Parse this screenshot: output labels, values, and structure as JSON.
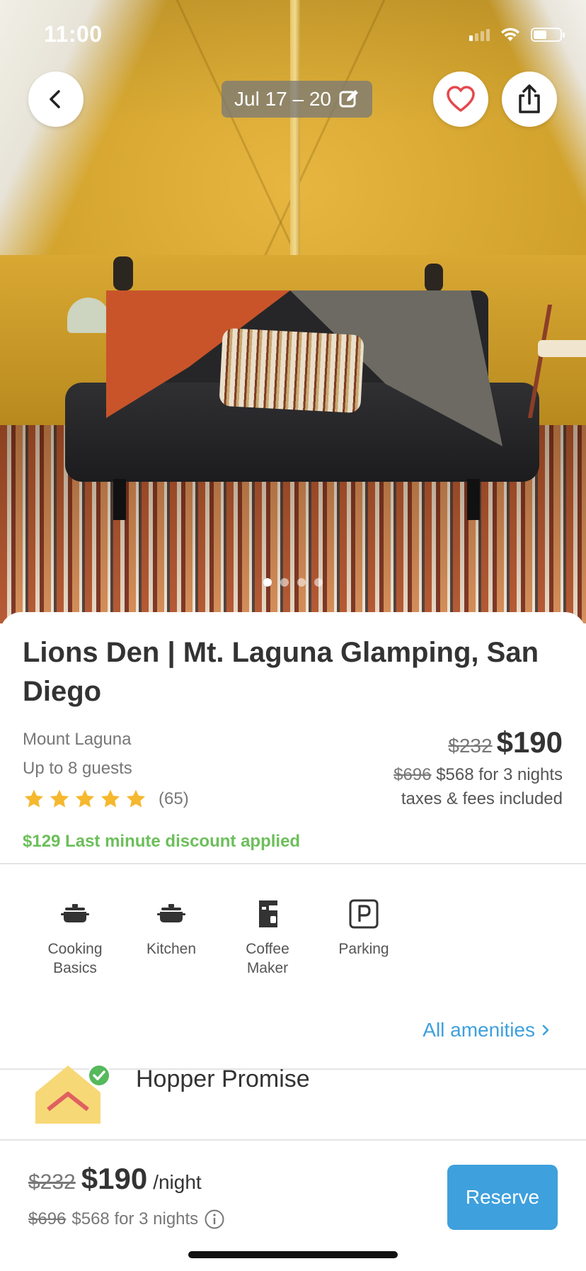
{
  "status_bar": {
    "time": "11:00"
  },
  "hero": {
    "dates": "Jul 17 – 20",
    "photo_count_dots": 4,
    "active_photo_index": 0
  },
  "listing": {
    "title": "Lions Den | Mt. Laguna Glamping, San Diego",
    "location": "Mount Laguna",
    "guests": "Up to 8 guests",
    "rating_stars": 5,
    "review_count": "(65)",
    "discount_text": "$129 Last minute discount applied",
    "price": {
      "original_nightly": "$232",
      "nightly": "$190",
      "original_total": "$696",
      "total_text": "$568 for 3 nights",
      "taxes_note": "taxes & fees included"
    }
  },
  "amenities": {
    "items": [
      {
        "label": "Cooking Basics",
        "icon": "cooking-pot-icon"
      },
      {
        "label": "Kitchen",
        "icon": "kitchen-pot-icon"
      },
      {
        "label": "Coffee Maker",
        "icon": "coffee-maker-icon"
      },
      {
        "label": "Parking",
        "icon": "parking-icon"
      }
    ],
    "all_link": "All amenities"
  },
  "promise": {
    "title": "Hopper Promise"
  },
  "bottom_bar": {
    "original_nightly": "$232",
    "nightly": "$190",
    "unit": "/night",
    "original_total": "$696",
    "total_text": "$568 for 3 nights",
    "reserve_label": "Reserve"
  },
  "colors": {
    "accent_blue": "#3ea0dd",
    "discount_green": "#6cbf5a",
    "star_yellow": "#f5b82e",
    "heart_red": "#e5484d"
  }
}
